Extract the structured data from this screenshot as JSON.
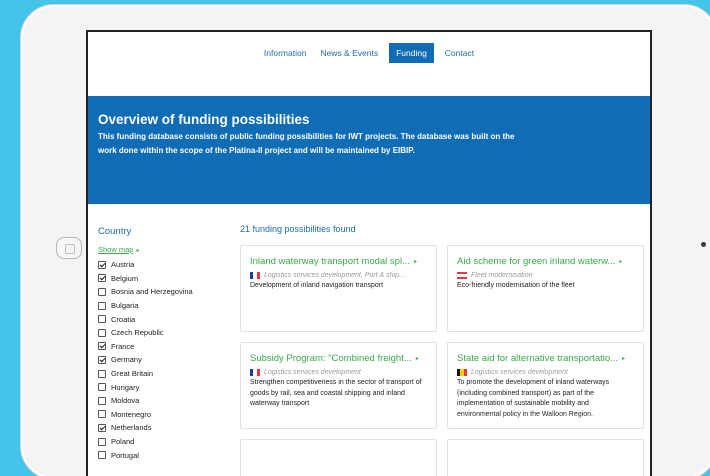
{
  "nav": {
    "items": [
      {
        "label": "Information",
        "active": false
      },
      {
        "label": "News & Events",
        "active": false
      },
      {
        "label": "Funding",
        "active": true
      },
      {
        "label": "Contact",
        "active": false
      }
    ]
  },
  "banner": {
    "title": "Overview of funding possibilities",
    "description": "This funding database consists of public funding possibilities for IWT projects. The database was built on the work done within the scope of the Platina-II project and will be maintained by EIBIP."
  },
  "sidebar": {
    "heading": "Country",
    "show_map": "Show map",
    "countries": [
      {
        "label": "Austria",
        "checked": true
      },
      {
        "label": "Belgium",
        "checked": true
      },
      {
        "label": "Bosnia and Herzegovina",
        "checked": false
      },
      {
        "label": "Bulgaria",
        "checked": false
      },
      {
        "label": "Croatia",
        "checked": false
      },
      {
        "label": "Czech Republic",
        "checked": false
      },
      {
        "label": "France",
        "checked": true
      },
      {
        "label": "Germany",
        "checked": true
      },
      {
        "label": "Great Britain",
        "checked": false
      },
      {
        "label": "Hungary",
        "checked": false
      },
      {
        "label": "Moldova",
        "checked": false
      },
      {
        "label": "Montenegro",
        "checked": false
      },
      {
        "label": "Netherlands",
        "checked": true
      },
      {
        "label": "Poland",
        "checked": false
      },
      {
        "label": "Portugal",
        "checked": false
      }
    ]
  },
  "results": {
    "count_text": "21 funding possibilities found",
    "cards": [
      {
        "title": "Inland waterway transport modal spl...",
        "flag": "france",
        "category": "Logistics services development, Port & ship...",
        "description": "Development of inland navigation transport"
      },
      {
        "title": "Aid scheme for green inland waterw...",
        "flag": "austria",
        "category": "Fleet modernisation",
        "description": "Eco-friendly modernisation of the fleet"
      },
      {
        "title": "Subsidy Program: \"Combined freight...",
        "flag": "france",
        "category": "Logistics services development",
        "description": "Strengthen competitiveness in the sector of transport of goods by rail, sea and coastal shipping and inland waterway transport"
      },
      {
        "title": "State aid for alternative transportatio...",
        "flag": "belgium",
        "category": "Logistics services development",
        "description": "To promote the development of inland waterways (including combined transport) as part of the implementation of sustainable mobility and environmental policy in the Walloon Region."
      }
    ]
  },
  "colors": {
    "background": "#45c4ea",
    "banner": "#0f6cb5",
    "link_blue": "#1e6bb0",
    "card_title_green": "#3aa84a"
  }
}
